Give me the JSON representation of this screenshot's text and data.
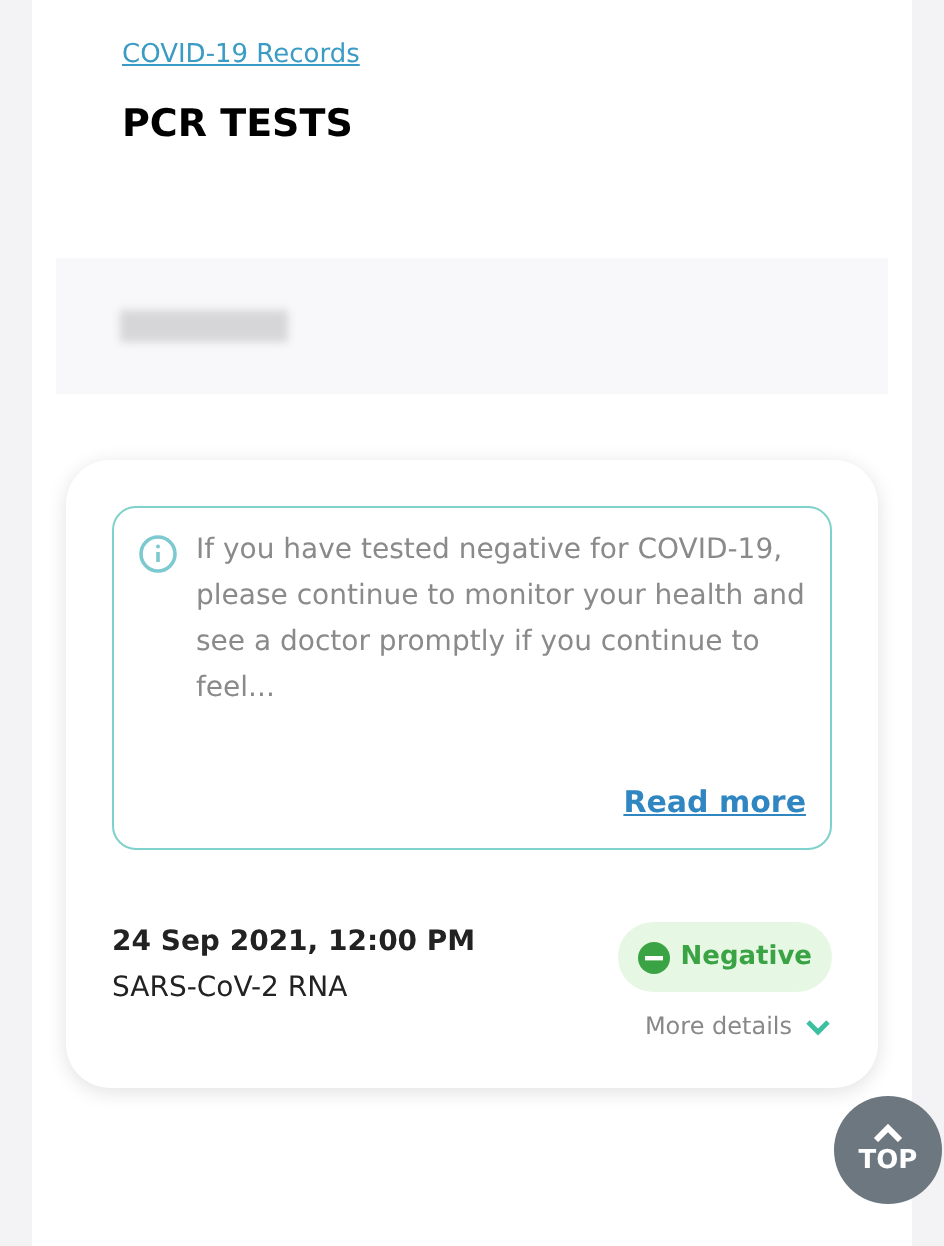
{
  "breadcrumb": "COVID-19 Records",
  "title": "PCR TESTS",
  "notice": {
    "text": "If you have tested negative for COVID-19, please continue to monitor your health and see a doctor promptly if you continue to feel...",
    "link": "Read more"
  },
  "result": {
    "datetime": "24 Sep 2021, 12:00 PM",
    "test": "SARS-CoV-2 RNA",
    "status": {
      "label": "Negative",
      "kind": "negative"
    },
    "details": {
      "label": "More details",
      "expanded": false
    }
  },
  "top_button": {
    "label": "TOP"
  }
}
